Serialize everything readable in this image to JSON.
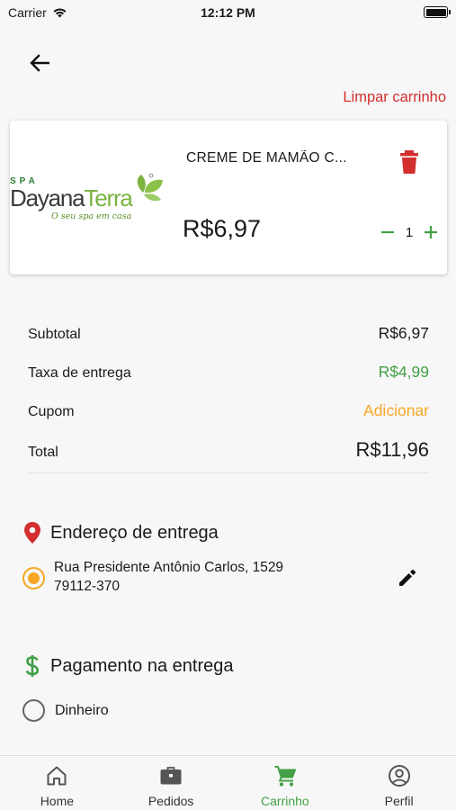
{
  "status_bar": {
    "carrier": "Carrier",
    "time": "12:12 PM"
  },
  "header": {
    "clear_cart_label": "Limpar carrinho"
  },
  "cart": {
    "items": [
      {
        "brand_small": "SPA",
        "brand_name_1": "Dayana",
        "brand_name_2": "Terra",
        "brand_tagline": "O seu spa em casa",
        "name": "CREME DE MAMÃO C...",
        "price": "R$6,97",
        "quantity": "1"
      }
    ]
  },
  "summary": {
    "subtotal_label": "Subtotal",
    "subtotal_value": "R$6,97",
    "delivery_label": "Taxa de entrega",
    "delivery_value": "R$4,99",
    "coupon_label": "Cupom",
    "coupon_action": "Adicionar",
    "total_label": "Total",
    "total_value": "R$11,96"
  },
  "address_section": {
    "title": "Endereço de entrega",
    "street": "Rua Presidente Antônio Carlos, 1529",
    "cep": "79112-370"
  },
  "payment_section": {
    "title": "Pagamento na entrega",
    "options": [
      "Dinheiro"
    ]
  },
  "tab_bar": {
    "tabs": [
      {
        "label": "Home",
        "icon": "home-icon"
      },
      {
        "label": "Pedidos",
        "icon": "briefcase-icon"
      },
      {
        "label": "Carrinho",
        "icon": "cart-icon",
        "active": true
      },
      {
        "label": "Perfil",
        "icon": "account-icon"
      }
    ]
  },
  "colors": {
    "accent_green": "#43a047",
    "danger_red": "#d32f2f",
    "coupon_orange": "#f9a825",
    "radio_orange": "#f5a623"
  }
}
